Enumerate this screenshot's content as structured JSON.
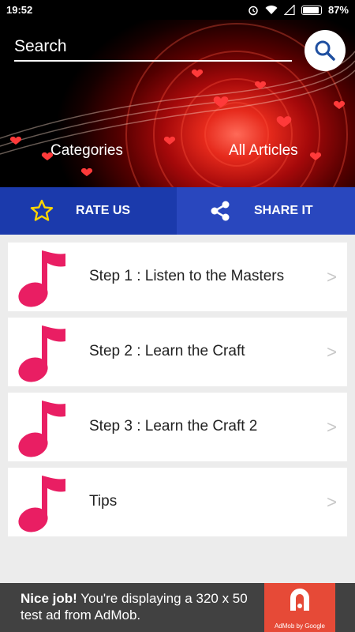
{
  "status_bar": {
    "time": "19:52",
    "battery": "87%"
  },
  "header": {
    "search_label": "Search",
    "tabs": [
      {
        "label": "Categories"
      },
      {
        "label": "All Articles"
      }
    ]
  },
  "actions": {
    "rate": {
      "label": "RATE US",
      "icon": "star-icon"
    },
    "share": {
      "label": "SHARE IT",
      "icon": "share-icon"
    }
  },
  "items": [
    {
      "title": "Step 1 : Listen to the Masters",
      "icon": "music-note-icon",
      "arrow": ">"
    },
    {
      "title": "Step 2 : Learn the Craft",
      "icon": "music-note-icon",
      "arrow": ">"
    },
    {
      "title": "Step 3 : Learn the Craft 2",
      "icon": "music-note-icon",
      "arrow": ">"
    },
    {
      "title": "Tips",
      "icon": "music-note-icon",
      "arrow": ">"
    }
  ],
  "ad": {
    "headline": "Nice job!",
    "body": " You're displaying a 320 x 50 test ad from AdMob.",
    "caption": "AdMob by Google"
  },
  "colors": {
    "rate_bg": "#1b3aac",
    "share_bg": "#2947be",
    "note": "#e91e63",
    "ad_red": "#e64a37"
  }
}
